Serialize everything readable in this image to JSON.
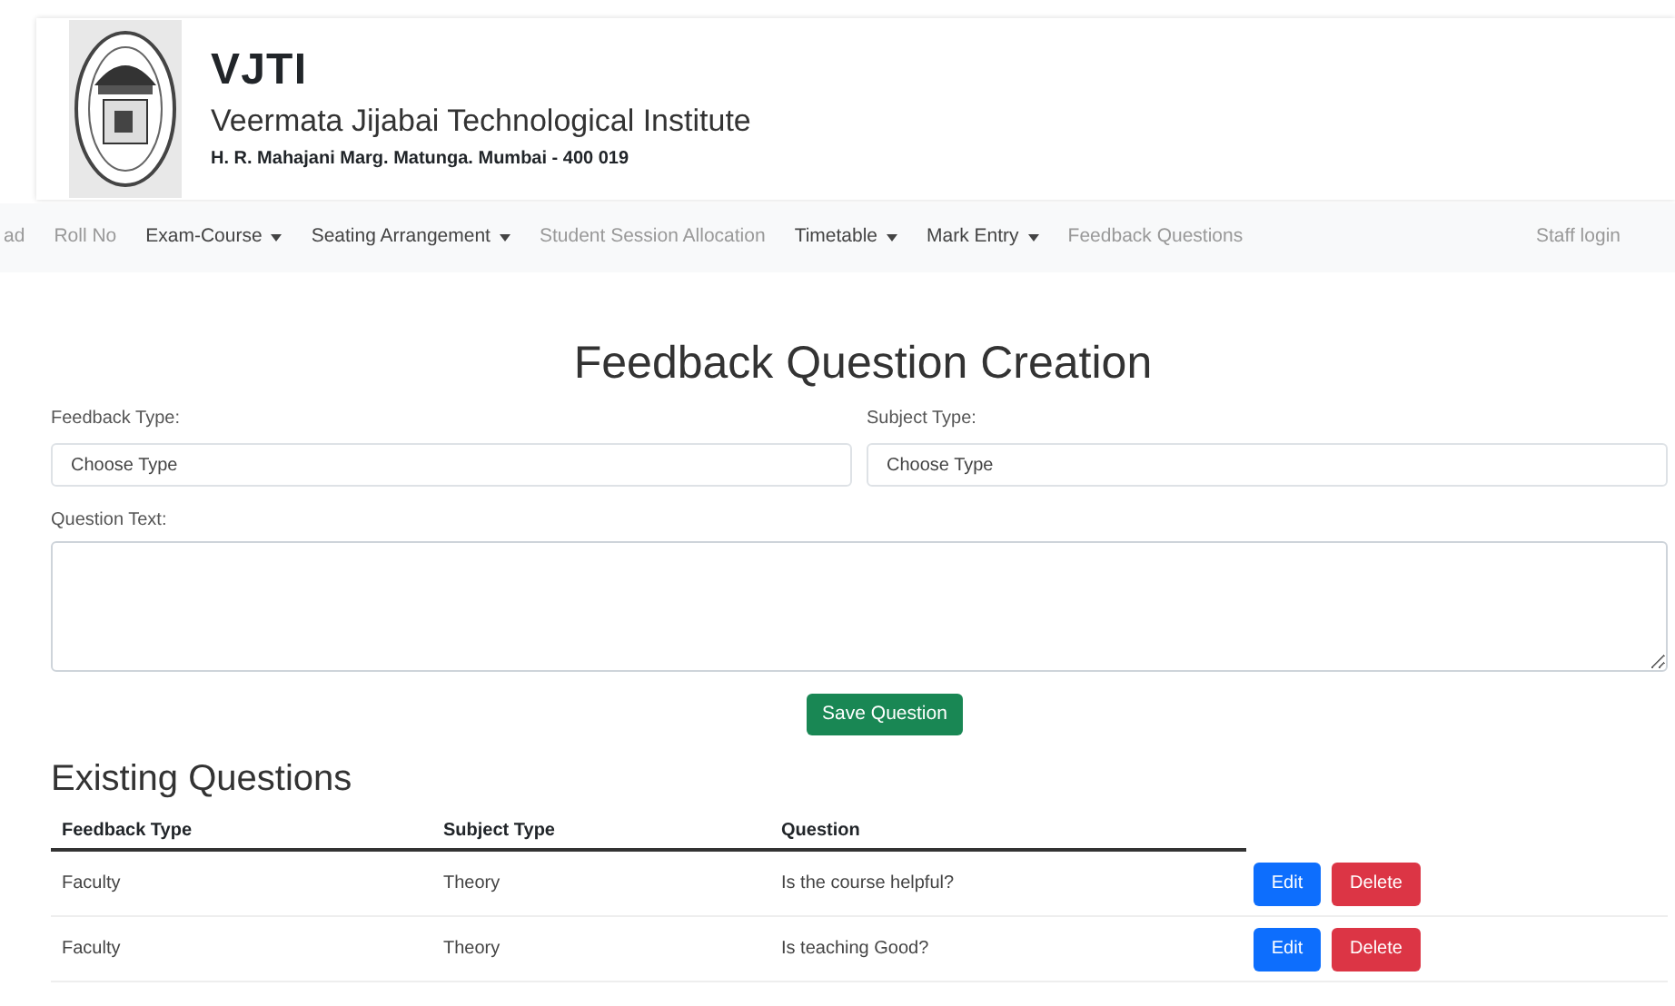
{
  "header": {
    "title": "VJTI",
    "subtitle": "Veermata Jijabai Technological Institute",
    "address": "H. R. Mahajani Marg. Matunga. Mumbai - 400 019"
  },
  "nav": {
    "items": [
      {
        "label": "ad",
        "kind": "link"
      },
      {
        "label": "Roll No",
        "kind": "link"
      },
      {
        "label": "Exam-Course",
        "kind": "dropdown"
      },
      {
        "label": "Seating Arrangement",
        "kind": "dropdown"
      },
      {
        "label": "Student Session Allocation",
        "kind": "link"
      },
      {
        "label": "Timetable",
        "kind": "dropdown"
      },
      {
        "label": "Mark Entry",
        "kind": "dropdown"
      },
      {
        "label": "Feedback Questions",
        "kind": "link"
      }
    ],
    "staff_login": "Staff login"
  },
  "page_title": "Feedback Question Creation",
  "form": {
    "feedback_type": {
      "label": "Feedback Type:",
      "value": "Choose Type"
    },
    "subject_type": {
      "label": "Subject Type:",
      "value": "Choose Type"
    },
    "question_text": {
      "label": "Question Text:"
    },
    "save_button": "Save Question"
  },
  "existing": {
    "title": "Existing Questions",
    "columns": [
      "Feedback Type",
      "Subject Type",
      "Question"
    ],
    "rows": [
      {
        "cells": [
          "Faculty",
          "Theory",
          "Is the course helpful?"
        ],
        "edit": "Edit",
        "delete": "Delete"
      },
      {
        "cells": [
          "Faculty",
          "Theory",
          "Is teaching Good?"
        ],
        "edit": "Edit",
        "delete": "Delete"
      }
    ]
  }
}
